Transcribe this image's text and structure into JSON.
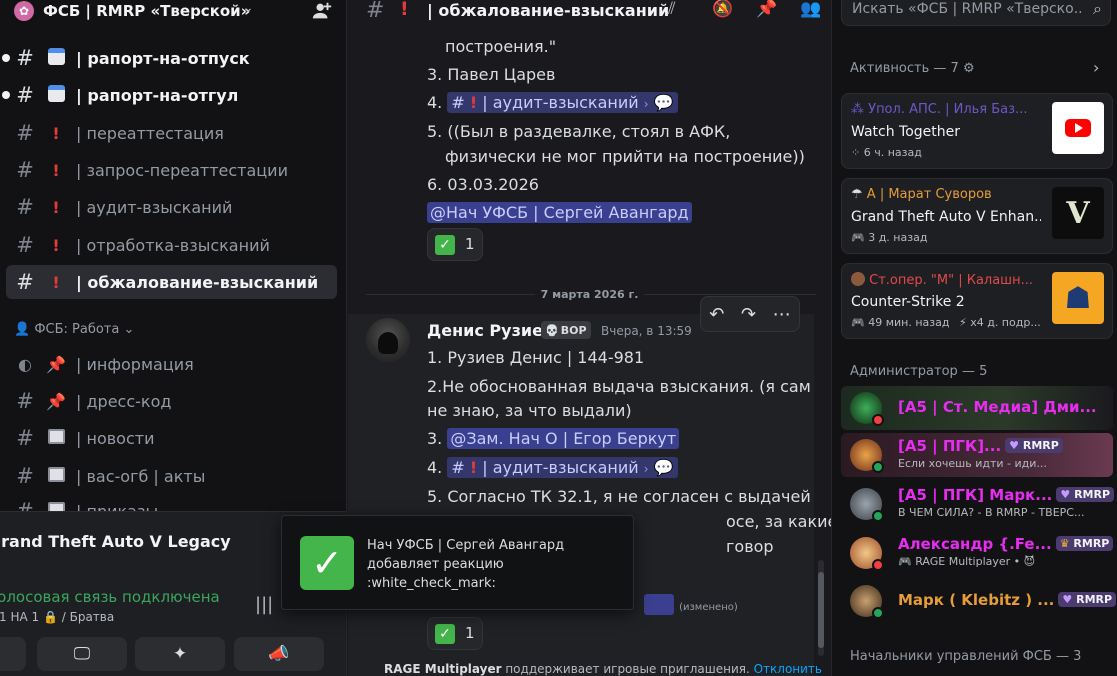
{
  "server": {
    "name": "ФСБ | RMRP «Тверской»"
  },
  "channels": [
    {
      "emoji": "calendar",
      "label": "| рапорт-на-отпуск",
      "bold": true
    },
    {
      "emoji": "calendar",
      "label": "| рапорт-на-отгул",
      "bold": true
    },
    {
      "emoji": "!",
      "label": "| переаттестация"
    },
    {
      "emoji": "!",
      "label": "| запрос-переаттестации"
    },
    {
      "emoji": "!",
      "label": "| аудит-взысканий"
    },
    {
      "emoji": "!",
      "label": "| отработка-взысканий"
    },
    {
      "emoji": "!",
      "label": "| обжалование-взысканий",
      "active": true
    }
  ],
  "category": "ФСБ: Работа",
  "channels2": [
    {
      "emoji": "pin",
      "label": "| информация"
    },
    {
      "emoji": "pin",
      "label": "| дресс-код"
    },
    {
      "emoji": "news",
      "label": "| новости"
    },
    {
      "emoji": "news",
      "label": "| вас-огб | акты"
    },
    {
      "emoji": "news",
      "label": "| приказы"
    }
  ],
  "voice": {
    "game": "Grand Theft Auto V Legacy",
    "status": "Голосовая связь подключена",
    "room": "1 НА 1",
    "room_suffix": "/ Братва"
  },
  "chat": {
    "channel_name": "| обжалование-взысканий",
    "msg1_lines": {
      "l0": "построения.\"",
      "l1": "3. Павел Царев",
      "l2_prefix": "4.",
      "l2_channel": "| аудит-взысканий",
      "l3": "5. ((Был в раздевалке, стоял в АФК,",
      "l4": "физически не мог прийти на построение))",
      "l5": "6. 03.03.2026",
      "mention": "@Нач УФСБ | Сергей Авангард"
    },
    "reaction_count": "1",
    "date_divider": "7 марта 2026 г.",
    "msg2": {
      "author": "Денис Рузиев",
      "tag": "BOP",
      "time": "Вчера, в 13:59",
      "l1": "1. Рузиев Денис | 144-981",
      "l2": "2.Не обоснованная выдача взыскания. (я сам",
      "l3": "не знаю, за что выдали)",
      "l4_prefix": "3.",
      "l4_mention": "@Зам. Нач О | Егор Беркут",
      "l5_prefix": "4.",
      "l5_channel": "| аудит-взысканий",
      "l6": "5. Согласно ТК 32.1, я не согласен с выдачей",
      "l7": "осе, за какие",
      "l8": "говор",
      "edited": "(изменено)",
      "reaction_count": "1"
    },
    "bottom_note_game": "RAGE Multiplayer",
    "bottom_note_text": " поддерживает игровые приглашения. ",
    "bottom_note_link": "Отклонить"
  },
  "toast": {
    "line1": "Нач УФСБ | Сергей Авангард",
    "line2": "добавляет реакцию",
    "line3": ":white_check_mark:"
  },
  "search": {
    "placeholder": "Искать «ФСБ | RMRP «Тверско..."
  },
  "activity": {
    "header": "Активность — 7",
    "cards": [
      {
        "user": "Упол. АПС. | Илья Баз...",
        "user_color": "#6e57c9",
        "game": "Watch Together",
        "time": "6 ч. назад",
        "icon": "youtube-icon"
      },
      {
        "user": "А | Марат Суворов",
        "user_color": "#e59c39",
        "game": "Grand Theft Auto V Enhan...",
        "time": "3 д. назад",
        "icon": "gta-icon"
      },
      {
        "user": "Ст.опер. \"М\" | Калашн...",
        "user_color": "#e04a4a",
        "game": "Counter-Strike 2",
        "time": "49 мин. назад",
        "extra": "x4 д. подр...",
        "icon": "cs2-icon"
      }
    ]
  },
  "admins": {
    "header": "Администратор — 5",
    "members": [
      {
        "name": "[А5 | Ст. Медиа] Дми...",
        "color": "#e62df0",
        "status": "dnd",
        "sub": "",
        "badge": ""
      },
      {
        "name": "[А5 | ПГК]...",
        "color": "#e62df0",
        "status": "online",
        "sub": "Если хочешь идти - иди...",
        "badge": "RMRP"
      },
      {
        "name": "[А5 | ПГК] Марк...",
        "color": "#e62df0",
        "status": "online",
        "sub": "В ЧЕМ СИЛА? - В RMRP - ТВЕРС...",
        "badge": "RMRP"
      },
      {
        "name": "Александр {.Fe...",
        "color": "#e62df0",
        "status": "dnd",
        "sub": "RAGE Multiplayer •",
        "badge": "RMRP"
      },
      {
        "name": "Марк ( Klebitz ) ...",
        "color": "#e59c39",
        "status": "online",
        "sub": "",
        "badge": "RMRP"
      }
    ]
  },
  "chiefs_header": "Начальники управлений ФСБ — 3",
  "colors": {
    "mention_bg": "#3b3f8f",
    "online": "#23a55a",
    "dnd": "#f23f43",
    "accent_red": "#e23b3b"
  }
}
